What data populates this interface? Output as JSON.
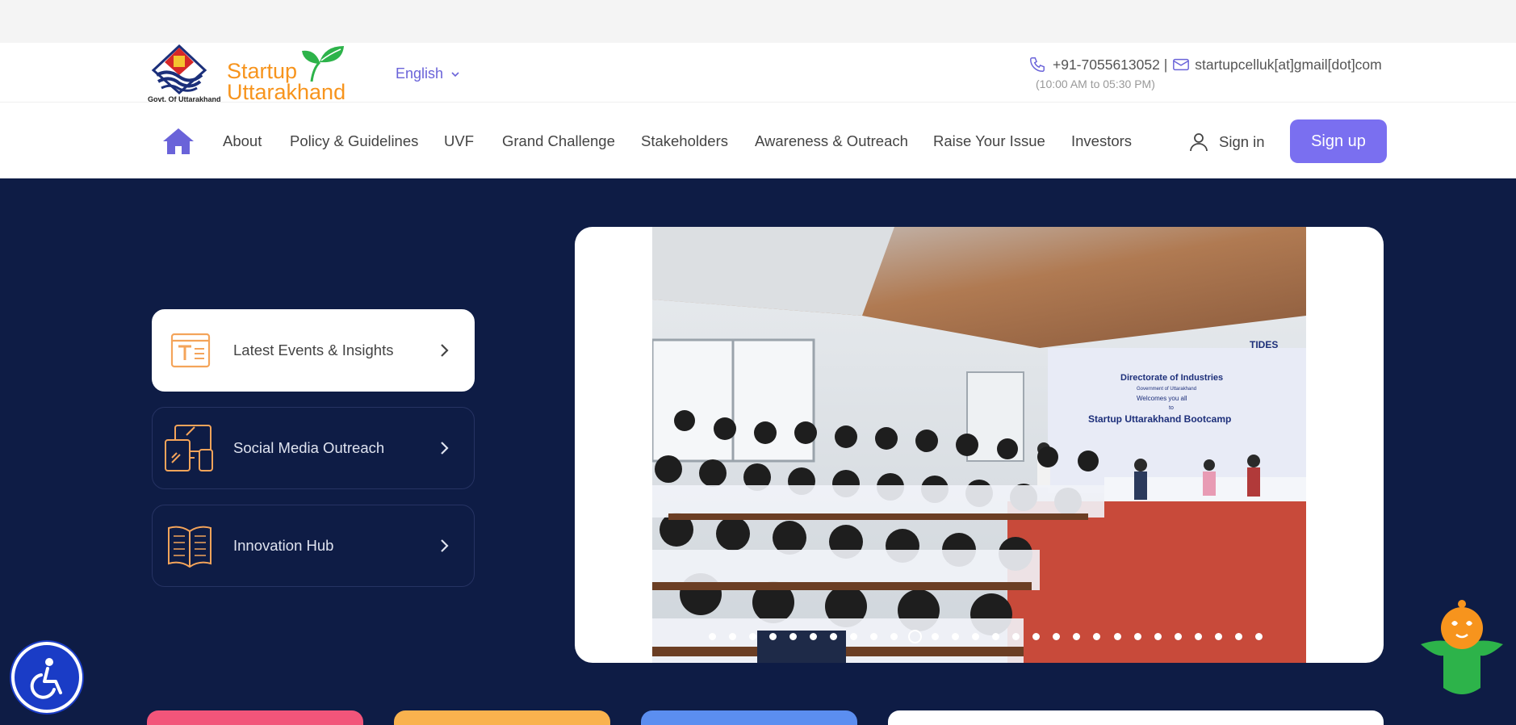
{
  "brand": {
    "gov_label": "Govt. Of Uttarakhand",
    "name_line1": "Startup",
    "name_line2": "Uttarakhand"
  },
  "language": {
    "selected": "English"
  },
  "contact": {
    "phone": "+91-7055613052 |",
    "email": "startupcelluk[at]gmail[dot]com",
    "hours": "(10:00 AM to 05:30 PM)"
  },
  "nav": {
    "items": [
      "About",
      "Policy & Guidelines",
      "UVF",
      "Grand Challenge",
      "Stakeholders",
      "Awareness & Outreach",
      "Raise Your Issue",
      "Investors"
    ],
    "signin": "Sign in",
    "signup": "Sign up"
  },
  "hero": {
    "cards": [
      {
        "label": "Latest Events & Insights",
        "icon": "news-icon",
        "active": true
      },
      {
        "label": "Social Media Outreach",
        "icon": "devices-icon",
        "active": false
      },
      {
        "label": "Innovation Hub",
        "icon": "book-icon",
        "active": false
      }
    ],
    "slider": {
      "slide_count": 28,
      "active_index": 10,
      "banner": {
        "line1": "Directorate of Industries",
        "line2": "Government of Uttarakhand",
        "line3": "Welcomes you all",
        "line4": "to",
        "title": "Startup Uttarakhand Bootcamp",
        "tides": "TIDES"
      }
    }
  },
  "colors": {
    "accent": "#7a6ff0",
    "hero_bg": "#0e1c45",
    "brand_orange": "#f7941d",
    "leaf_green": "#2db34a",
    "accessibility_blue": "#1a3cc6"
  },
  "bottom_cards": [
    "#f2557a",
    "#f9b24e",
    "#5b8ef0",
    "#ffffff"
  ]
}
